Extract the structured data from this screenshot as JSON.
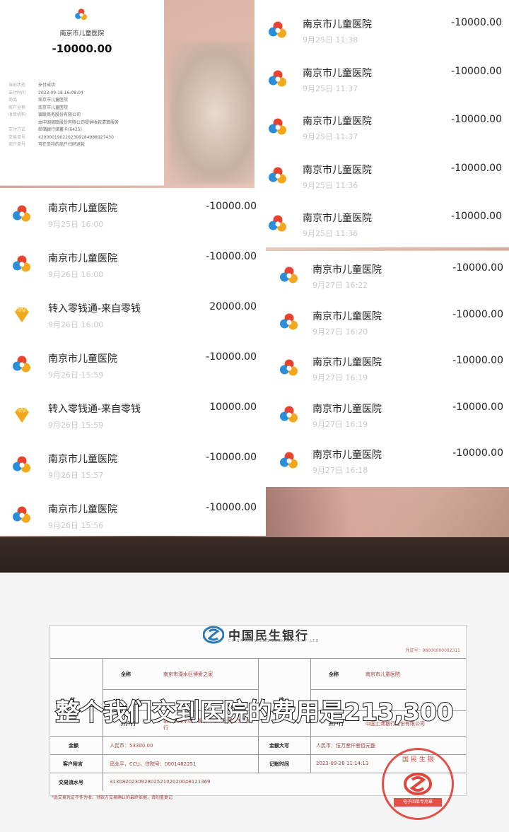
{
  "detail": {
    "merchant": "南京市儿童医院",
    "amount": "-10000.00",
    "rows": [
      {
        "k": "当前状态",
        "v": "支付成功"
      },
      {
        "k": "支付时间",
        "v": "2023-09-18 16:08:04"
      },
      {
        "k": "商品",
        "v": "南京市儿童医院"
      },
      {
        "k": "商户全称",
        "v": "南京市儿童医院"
      },
      {
        "k": "收单机构",
        "v": "银联商务股份有限公司"
      },
      {
        "k": "",
        "v": "由中国银联股份有限公司提供收款清算服务"
      },
      {
        "k": "支付方式",
        "v": "邮储银行储蓄卡(6425)"
      },
      {
        "k": "交易单号",
        "v": "4200001902202309184988927430"
      },
      {
        "k": "商户单号",
        "v": "可在支持的商户扫码退款"
      }
    ]
  },
  "panel_top_right": [
    {
      "name": "南京市儿童医院",
      "time": "9月25日 11:38",
      "amount": "-10000.00"
    },
    {
      "name": "南京市儿童医院",
      "time": "9月25日 11:37",
      "amount": "-10000.00"
    },
    {
      "name": "南京市儿童医院",
      "time": "9月25日 11:37",
      "amount": "-10000.00"
    },
    {
      "name": "南京市儿童医院",
      "time": "9月25日 11:36",
      "amount": "-10000.00"
    },
    {
      "name": "南京市儿童医院",
      "time": "9月25日 11:36",
      "amount": "-10000.00"
    }
  ],
  "panel_mid_right": [
    {
      "name": "南京市儿童医院",
      "time": "9月27日 16:22",
      "amount": "-10000.00"
    },
    {
      "name": "南京市儿童医院",
      "time": "9月27日 16:20",
      "amount": "-10000.00"
    },
    {
      "name": "南京市儿童医院",
      "time": "9月27日 16:19",
      "amount": "-10000.00"
    },
    {
      "name": "南京市儿童医院",
      "time": "9月27日 16:19",
      "amount": "-10000.00"
    },
    {
      "name": "南京市儿童医院",
      "time": "9月27日 16:18",
      "amount": "-10000.00"
    }
  ],
  "panel_mid_left": [
    {
      "name": "南京市儿童医院",
      "time": "9月25日 16:00",
      "amount": "-10000.00",
      "icon": "hospital-logo-icon"
    },
    {
      "name": "南京市儿童医院",
      "time": "9月26日 16:00",
      "amount": "-10000.00",
      "icon": "hospital-logo-icon"
    },
    {
      "name": "转入零钱通-来自零钱",
      "time": "9月26日 16:00",
      "amount": "20000.00",
      "icon": "diamond-icon"
    },
    {
      "name": "南京市儿童医院",
      "time": "9月26日 15:59",
      "amount": "-10000.00",
      "icon": "hospital-logo-icon"
    },
    {
      "name": "转入零钱通-来自零钱",
      "time": "9月26日 15:59",
      "amount": "10000.00",
      "icon": "diamond-icon"
    },
    {
      "name": "南京市儿童医院",
      "time": "9月26日 15:57",
      "amount": "-10000.00",
      "icon": "hospital-logo-icon"
    },
    {
      "name": "南京市儿童医院",
      "time": "9月26日 15:56",
      "amount": "-10000.00",
      "icon": "hospital-logo-icon"
    }
  ],
  "slip": {
    "bank_name": "中国民生银行",
    "bank_en": "CHINA MINSHENG BANKING CORP.,LTD",
    "voucher": "凭证号：98000000002311",
    "payer_label": "付",
    "payee_label": "收",
    "fullname_label": "全称",
    "payer_name": "南京市溧水区博爱之家",
    "payee_name": "南京市儿童医院",
    "bank_label": "开户行",
    "payer_bank": "南京市溧水区...股份有限公司博爱五武支行",
    "payee_bank": "中国工商银行股份有限公司",
    "amount_label": "金额",
    "amount_value": "人民币：53300.00",
    "amount_upper_label": "金额大写",
    "amount_upper_value": "人民币：伍万叁仟叁佰元整",
    "remark_label": "客户附言",
    "remark_value": "邱允平，CCU，住院号：0001482251",
    "time_label": "记账时间",
    "time_value": "2023-09-28 11:14:13",
    "serial_label": "交易流水号",
    "serial_value": "31308202309280252102020048121369",
    "footnote": "*此交易凭证不作为收、付款方交易确认的最终依据，请勿重复记"
  },
  "stamp": {
    "text_top": "国 民 生 银",
    "band": "电子回单专用章"
  },
  "subtitle": "整个我们交到医院的费用是213,300"
}
